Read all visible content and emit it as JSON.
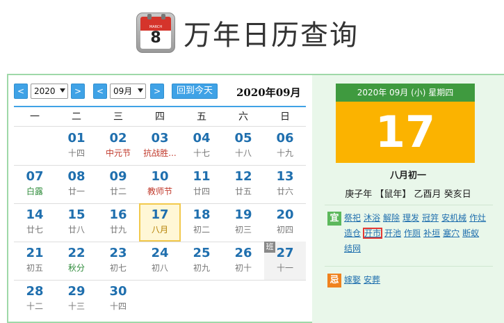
{
  "header": {
    "title": "万年日历查询",
    "icon_month": "MARCH",
    "icon_day": "8"
  },
  "controls": {
    "prev_symbol": "<",
    "next_symbol": ">",
    "year_value": "2020",
    "month_value": "09月",
    "today_label": "回到今天",
    "month_title": "2020年09月"
  },
  "weekdays": [
    "一",
    "二",
    "三",
    "四",
    "五",
    "六",
    "日"
  ],
  "calendar": {
    "cells": [
      {
        "d": "01",
        "sub": "十四"
      },
      {
        "d": "02",
        "sub": "中元节"
      },
      {
        "d": "03",
        "sub": "抗战胜..."
      },
      {
        "d": "04",
        "sub": "十七"
      },
      {
        "d": "05",
        "sub": "十八"
      },
      {
        "d": "06",
        "sub": "十九"
      },
      {
        "d": "07",
        "sub": "白露"
      },
      {
        "d": "08",
        "sub": "廿一"
      },
      {
        "d": "09",
        "sub": "廿二"
      },
      {
        "d": "10",
        "sub": "教师节"
      },
      {
        "d": "11",
        "sub": "廿四"
      },
      {
        "d": "12",
        "sub": "廿五"
      },
      {
        "d": "13",
        "sub": "廿六"
      },
      {
        "d": "14",
        "sub": "廿七"
      },
      {
        "d": "15",
        "sub": "廿八"
      },
      {
        "d": "16",
        "sub": "廿九"
      },
      {
        "d": "17",
        "sub": "八月"
      },
      {
        "d": "18",
        "sub": "初二"
      },
      {
        "d": "19",
        "sub": "初三"
      },
      {
        "d": "20",
        "sub": "初四"
      },
      {
        "d": "21",
        "sub": "初五"
      },
      {
        "d": "22",
        "sub": "秋分"
      },
      {
        "d": "23",
        "sub": "初七"
      },
      {
        "d": "24",
        "sub": "初八"
      },
      {
        "d": "25",
        "sub": "初九"
      },
      {
        "d": "26",
        "sub": "初十"
      },
      {
        "d": "27",
        "sub": "十一"
      },
      {
        "d": "28",
        "sub": "十二"
      },
      {
        "d": "29",
        "sub": "十三"
      },
      {
        "d": "30",
        "sub": "十四"
      }
    ],
    "workday_badge": "班"
  },
  "detail": {
    "date_header": "2020年 09月 (小) 星期四",
    "day": "17",
    "lunar": "八月初一",
    "ganzhi": "庚子年 【鼠年】 乙酉月 癸亥日",
    "yi_label": "宜",
    "ji_label": "忌",
    "yi_items": [
      "祭祀",
      "沐浴",
      "解除",
      "理发",
      "冠笄",
      "安机械",
      "作灶",
      "造仓",
      "开市",
      "开池",
      "作厕",
      "补垣",
      "塞穴",
      "断蚁",
      "结网"
    ],
    "ji_items": [
      "嫁娶",
      "安葬"
    ]
  },
  "colors": {
    "accent_blue": "#3fa2e6",
    "date_green": "#3f9a3f",
    "day_orange": "#fbb300",
    "yi_green": "#5cb85c",
    "ji_orange": "#f0821e",
    "holiday_red": "#c0392b",
    "term_green": "#2e8b3a"
  }
}
